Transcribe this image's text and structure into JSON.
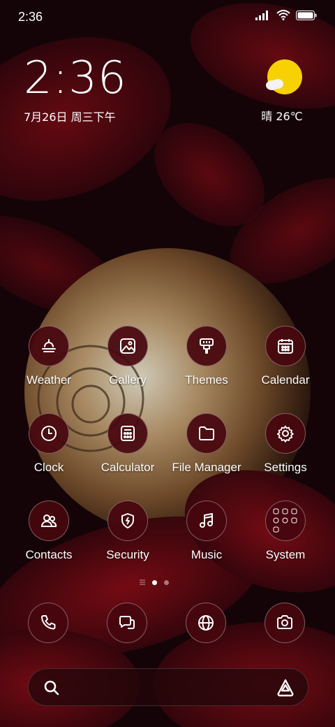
{
  "status_bar": {
    "time": "2:36"
  },
  "clock_widget": {
    "time": "2:36",
    "date": "7月26日 周三下午"
  },
  "weather_widget": {
    "condition_temp": "晴 26℃",
    "icon": "sun-cloud-icon"
  },
  "apps": [
    {
      "label": "Weather",
      "icon": "weather-icon"
    },
    {
      "label": "Gallery",
      "icon": "gallery-icon"
    },
    {
      "label": "Themes",
      "icon": "themes-icon"
    },
    {
      "label": "Calendar",
      "icon": "calendar-icon"
    },
    {
      "label": "Clock",
      "icon": "clock-icon"
    },
    {
      "label": "Calculator",
      "icon": "calculator-icon"
    },
    {
      "label": "File Manager",
      "icon": "folder-icon"
    },
    {
      "label": "Settings",
      "icon": "gear-icon"
    },
    {
      "label": "Contacts",
      "icon": "contacts-icon"
    },
    {
      "label": "Security",
      "icon": "shield-icon"
    },
    {
      "label": "Music",
      "icon": "music-icon"
    },
    {
      "label": "System",
      "icon": "folder-grid-icon"
    }
  ],
  "page_indicator": {
    "pages": 2,
    "active": 1
  },
  "dock": [
    {
      "icon": "phone-icon"
    },
    {
      "icon": "messages-icon"
    },
    {
      "icon": "browser-icon"
    },
    {
      "icon": "camera-icon"
    }
  ],
  "search_bar": {
    "left_icon": "search-icon",
    "right_icon": "assistant-icon"
  },
  "colors": {
    "icon_bg": "#46060e",
    "weather_sun": "#f8d100"
  }
}
